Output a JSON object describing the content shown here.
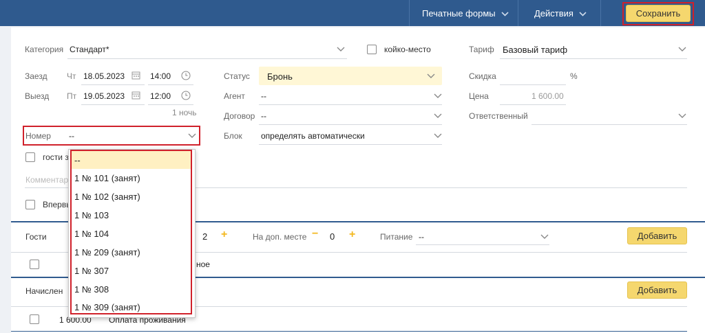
{
  "header": {
    "print_forms": "Печатные формы",
    "actions": "Действия",
    "save": "Сохранить"
  },
  "form": {
    "category_label": "Категория",
    "category_value": "Стандарт*",
    "bed_place_label": "койко-место",
    "tariff_label": "Тариф",
    "tariff_value": "Базовый тариф",
    "checkin_label": "Заезд",
    "checkin_day": "Чт",
    "checkin_date": "18.05.2023",
    "checkin_time": "14:00",
    "checkout_label": "Выезд",
    "checkout_day": "Пт",
    "checkout_date": "19.05.2023",
    "checkout_time": "12:00",
    "nights": "1 ночь",
    "status_label": "Статус",
    "status_value": "Бронь",
    "agent_label": "Агент",
    "agent_value": "--",
    "contract_label": "Договор",
    "contract_value": "--",
    "block_label": "Блок",
    "block_value": "определять автоматически",
    "discount_label": "Скидка",
    "discount_unit": "%",
    "price_label": "Цена",
    "price_value": "1 600.00",
    "responsible_label": "Ответственный",
    "room_label": "Номер",
    "room_value": "--",
    "guests_checkbox_label": "гости з",
    "comment_placeholder": "Комментар",
    "first_time_label": "Впервы"
  },
  "guests": {
    "label": "Гости",
    "count": "2",
    "extra_label": "На доп. месте",
    "extra_count": "0",
    "food_label": "Питание",
    "food_value": "--",
    "add": "Добавить",
    "row_text": "ное"
  },
  "charges": {
    "label": "Начислен",
    "add": "Добавить",
    "row_amount": "1 600.00",
    "row_text": "Оплата проживания"
  },
  "room_dropdown": {
    "options": [
      "--",
      "1 № 101 (занят)",
      "1 № 102 (занят)",
      "1 № 103",
      "1 № 104",
      "1 № 209 (занят)",
      "1 № 307",
      "1 № 308",
      "1 № 309 (занят)"
    ]
  },
  "colors": {
    "header_bg": "#2f5a8e",
    "accent_yellow": "#f5d76e",
    "highlight_red": "#d0202a"
  }
}
